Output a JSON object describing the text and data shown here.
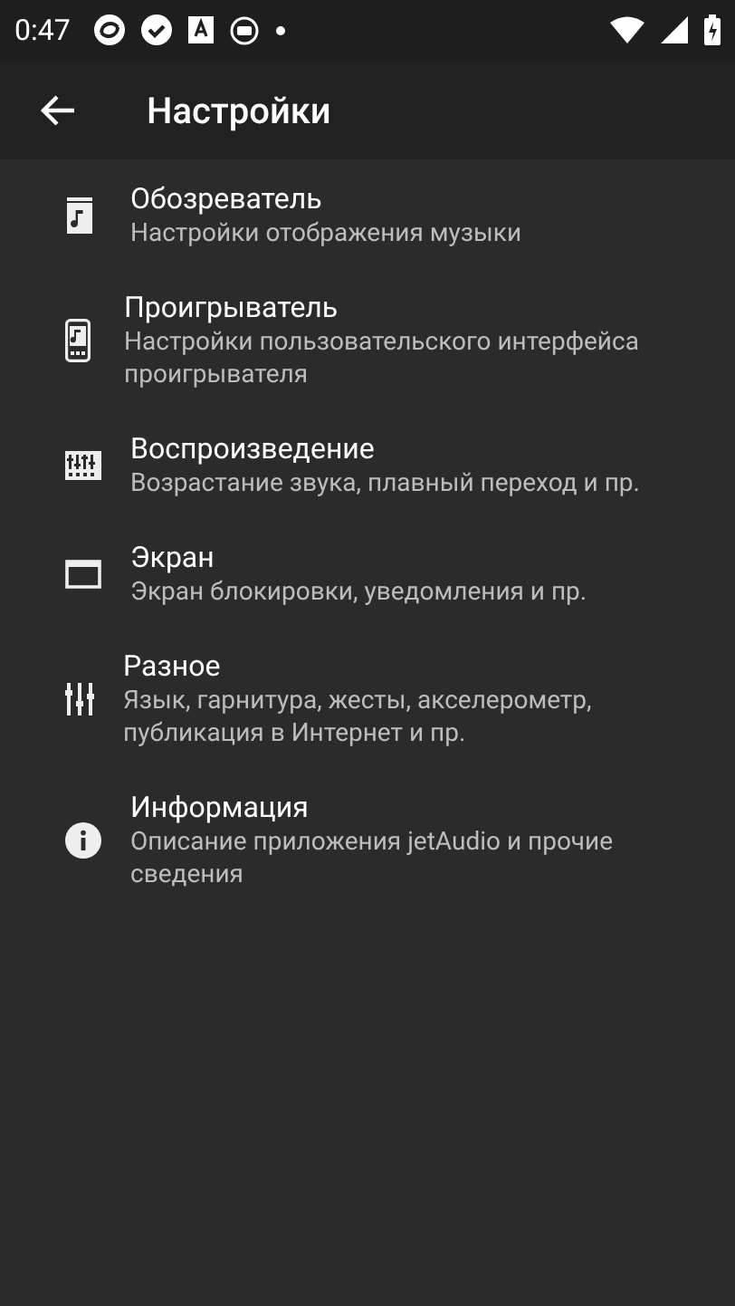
{
  "status_bar": {
    "time": "0:47"
  },
  "app_bar": {
    "title": "Настройки"
  },
  "items": [
    {
      "kind": "browser",
      "title": "Обозреватель",
      "summary": "Настройки отображения музыки"
    },
    {
      "kind": "player",
      "title": "Проигрыватель",
      "summary": "Настройки пользовательского интерфейса проигрывателя"
    },
    {
      "kind": "playback",
      "title": "Воспроизведение",
      "summary": "Возрастание звука, плавный переход и пр."
    },
    {
      "kind": "screen",
      "title": "Экран",
      "summary": "Экран блокировки, уведомления и пр."
    },
    {
      "kind": "misc",
      "title": "Разное",
      "summary": "Язык, гарнитура, жесты, акселерометр, публикация в Интернет и пр."
    },
    {
      "kind": "info",
      "title": "Информация",
      "summary": "Описание приложения jetAudio и прочие сведения"
    }
  ]
}
